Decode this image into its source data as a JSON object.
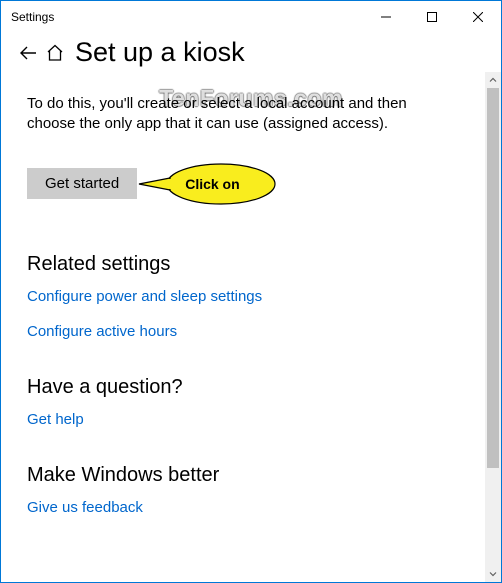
{
  "window": {
    "title": "Settings"
  },
  "page": {
    "title": "Set up a kiosk",
    "description": "To do this, you'll create or select a local account and then choose the only app that it can use (assigned access).",
    "get_started_label": "Get started"
  },
  "callout": {
    "text": "Click on"
  },
  "sections": {
    "related": {
      "title": "Related settings",
      "links": {
        "power_sleep": "Configure power and sleep settings",
        "active_hours": "Configure active hours"
      }
    },
    "question": {
      "title": "Have a question?",
      "links": {
        "get_help": "Get help"
      }
    },
    "better": {
      "title": "Make Windows better",
      "links": {
        "feedback": "Give us feedback"
      }
    }
  },
  "watermark": "TenForums.com"
}
